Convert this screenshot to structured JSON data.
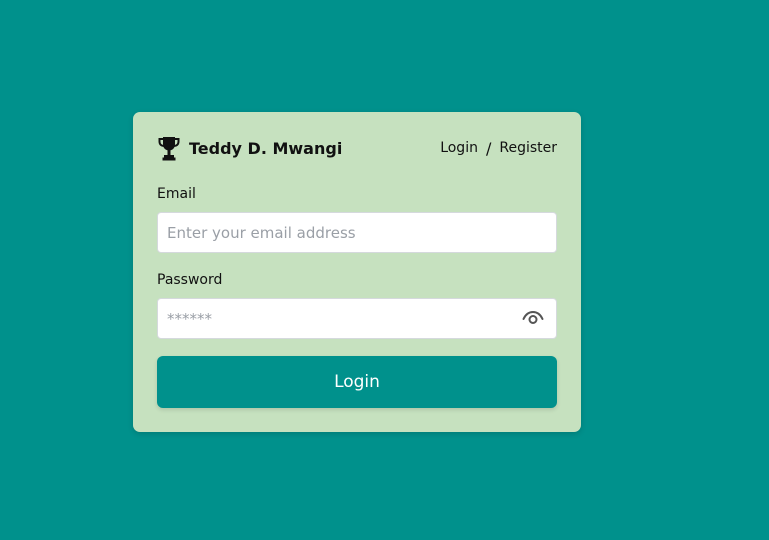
{
  "brand": {
    "icon": "trophy-icon",
    "name": "Teddy D. Mwangi"
  },
  "nav": {
    "login_label": "Login",
    "separator": "/",
    "register_label": "Register"
  },
  "form": {
    "email_label": "Email",
    "email_placeholder": "Enter your email address",
    "password_label": "Password",
    "password_placeholder": "******",
    "toggle_icon": "eye-icon",
    "submit_label": "Login"
  },
  "colors": {
    "background": "#00918c",
    "card": "#c6e1bf",
    "button": "#00918c",
    "button_text": "#ffffff"
  }
}
